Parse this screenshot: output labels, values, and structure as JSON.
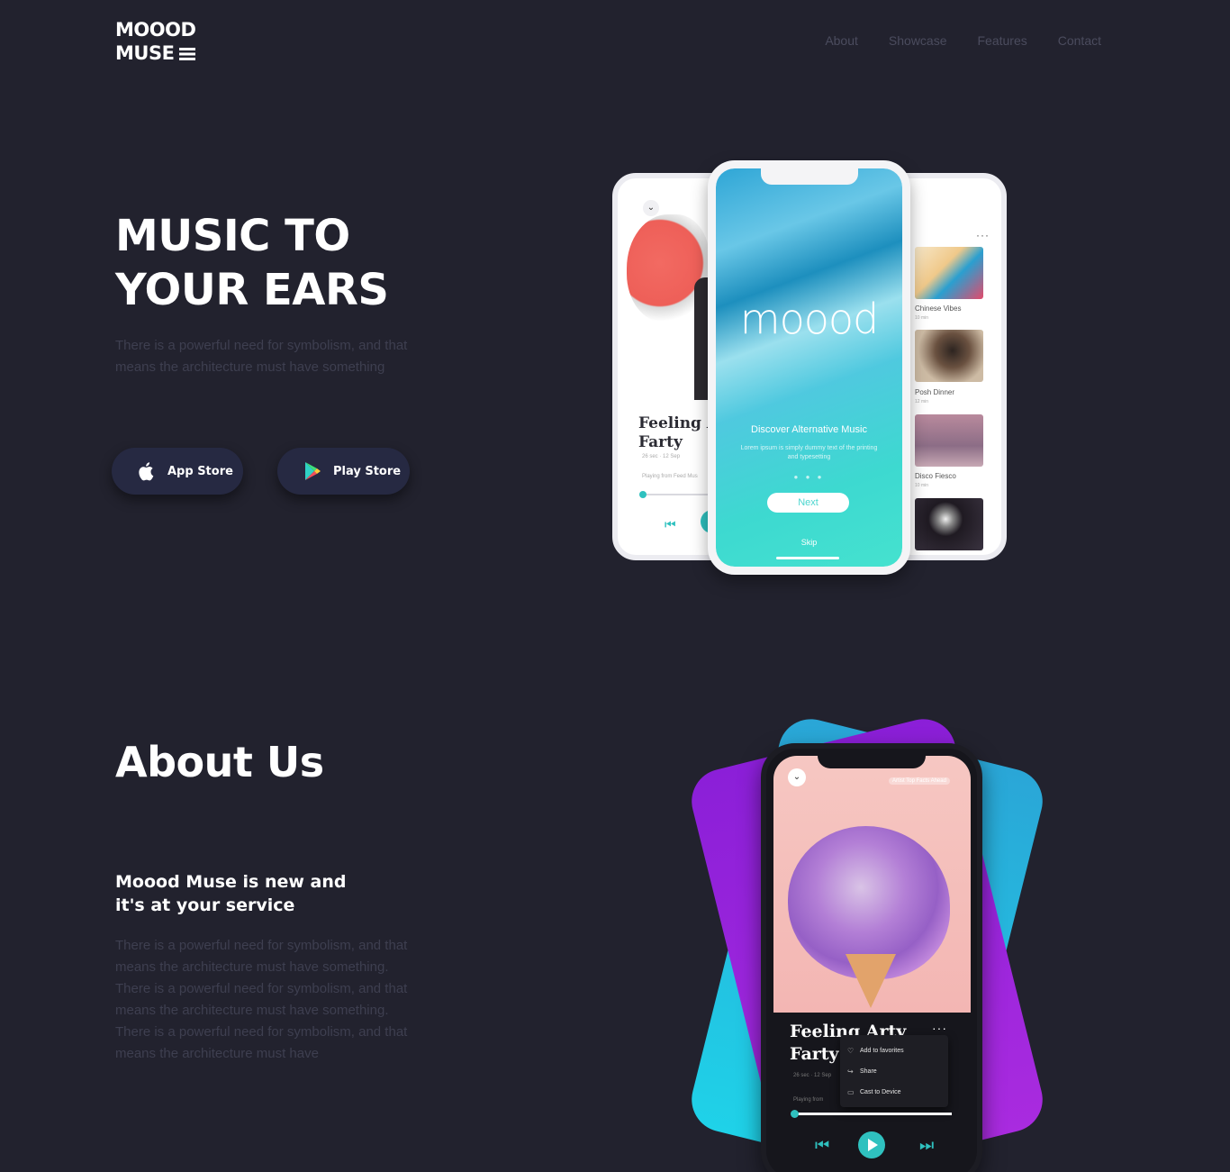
{
  "header": {
    "logo_line1": "MOOOD",
    "logo_line2": "MUSE",
    "nav": [
      "About",
      "Showcase",
      "Features",
      "Contact"
    ]
  },
  "hero": {
    "title": "MUSIC TO\nYOUR EARS",
    "text": "There is a powerful need for symbolism, and that means the architecture must have something",
    "app_store_label": "App Store",
    "play_store_label": "Play Store"
  },
  "phones": {
    "center": {
      "brand": "moood",
      "heading": "Discover Alternative Music",
      "subtext": "Lorem ipsum is simply dummy text of the printing and typesetting",
      "next": "Next",
      "skip": "Skip"
    },
    "left": {
      "title": "Feeling A\nFarty",
      "meta": "26 sec · 12 Sep",
      "playing_from": "Playing from  Feed Mus"
    },
    "right": {
      "playlists": [
        {
          "name": "Chinese Vibes",
          "sub": "10 min"
        },
        {
          "name": "Posh Dinner",
          "sub": "12 min"
        },
        {
          "name": "Disco Fiesco",
          "sub": "10 min"
        }
      ]
    }
  },
  "about": {
    "title": "About Us",
    "subtitle": "Moood Muse is new and\nit's at your service",
    "text": "There is a powerful need for symbolism, and that means the architecture must have something. There is a powerful need for symbolism, and that means the architecture must have something. There is a powerful need for symbolism, and that means the architecture must have",
    "phone": {
      "badge": "Artist Top Facts Ahead",
      "title": "Feeling Arty\nFarty",
      "meta": "26 sec · 12 Sep",
      "playing_from": "Playing from",
      "menu": [
        "Add to favorites",
        "Share",
        "Cast to Device"
      ]
    }
  },
  "colors": {
    "background": "#22222e",
    "muted_text": "#3e3f50",
    "accent_teal": "#2fc1bf",
    "button_bg": "#262942",
    "card_purple": "#8b1fd8",
    "card_cyan": "#1fd2e8"
  }
}
